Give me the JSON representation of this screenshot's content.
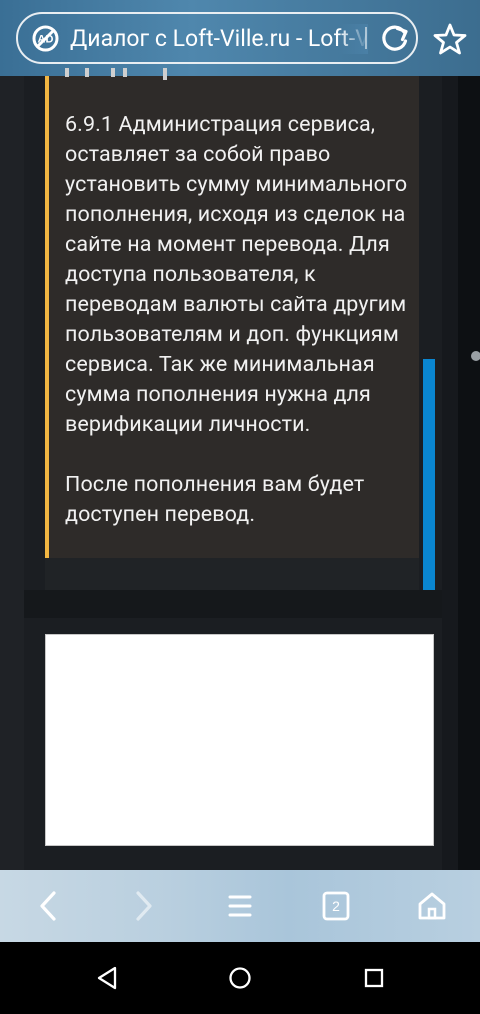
{
  "browser": {
    "page_title": "Диалог с Loft-Ville.ru - Loft-Ville",
    "tabs_count": "2"
  },
  "message": {
    "text": "6.9.1 Администрация сервиса, оставляет за собой право установить сумму минимального пополнения, исходя из сделок на сайте на момент перевода. Для доступа пользователя, к переводам валюты сайта другим пользователям и доп. функциям сервиса. Так же минимальная сумма пополнения нужна для верификации личности.\n\nПосле пополнения вам будет доступен перевод."
  },
  "colors": {
    "accent_bar": "#f2b642",
    "scrollbar": "#0a86d0",
    "message_bg": "#2e2b29",
    "toolbar": "#b9cfdf"
  },
  "icons": {
    "adblock": "no-ads-icon",
    "reload": "reload-icon",
    "bookmark": "star-icon",
    "back": "chevron-left-icon",
    "forward": "chevron-right-icon",
    "menu": "menu-icon",
    "tabs": "tabs-icon",
    "home": "home-icon",
    "sys_back": "triangle-back-icon",
    "sys_home": "circle-home-icon",
    "sys_recents": "square-recents-icon"
  }
}
